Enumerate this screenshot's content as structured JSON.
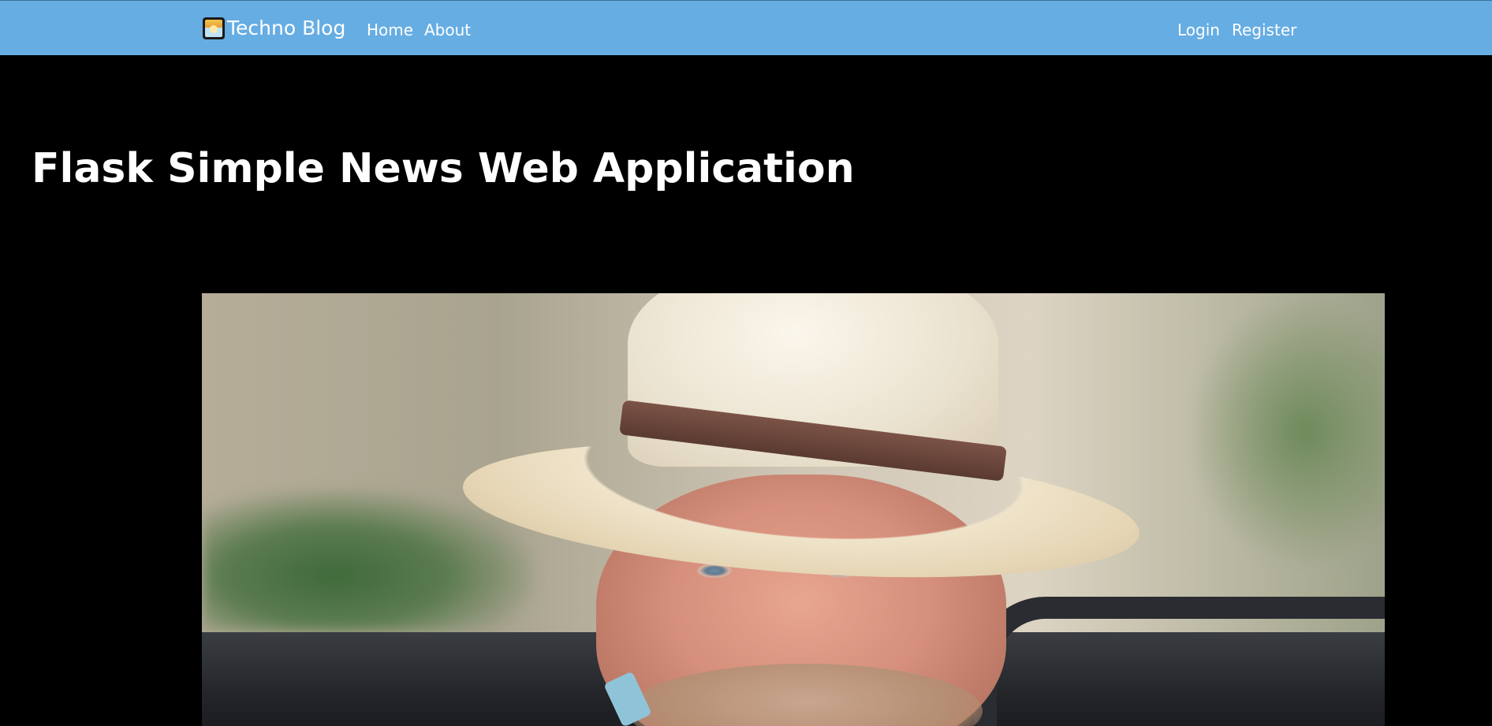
{
  "navbar": {
    "brand_icon": "blog-logo-icon",
    "brand_text": "Techno Blog",
    "links": [
      {
        "label": "Home"
      },
      {
        "label": "About"
      }
    ],
    "auth_links": [
      {
        "label": "Login"
      },
      {
        "label": "Register"
      }
    ],
    "background_color": "#66ade3"
  },
  "hero": {
    "title": "Flask Simple News Web Application"
  },
  "page": {
    "background_color": "#000000"
  }
}
